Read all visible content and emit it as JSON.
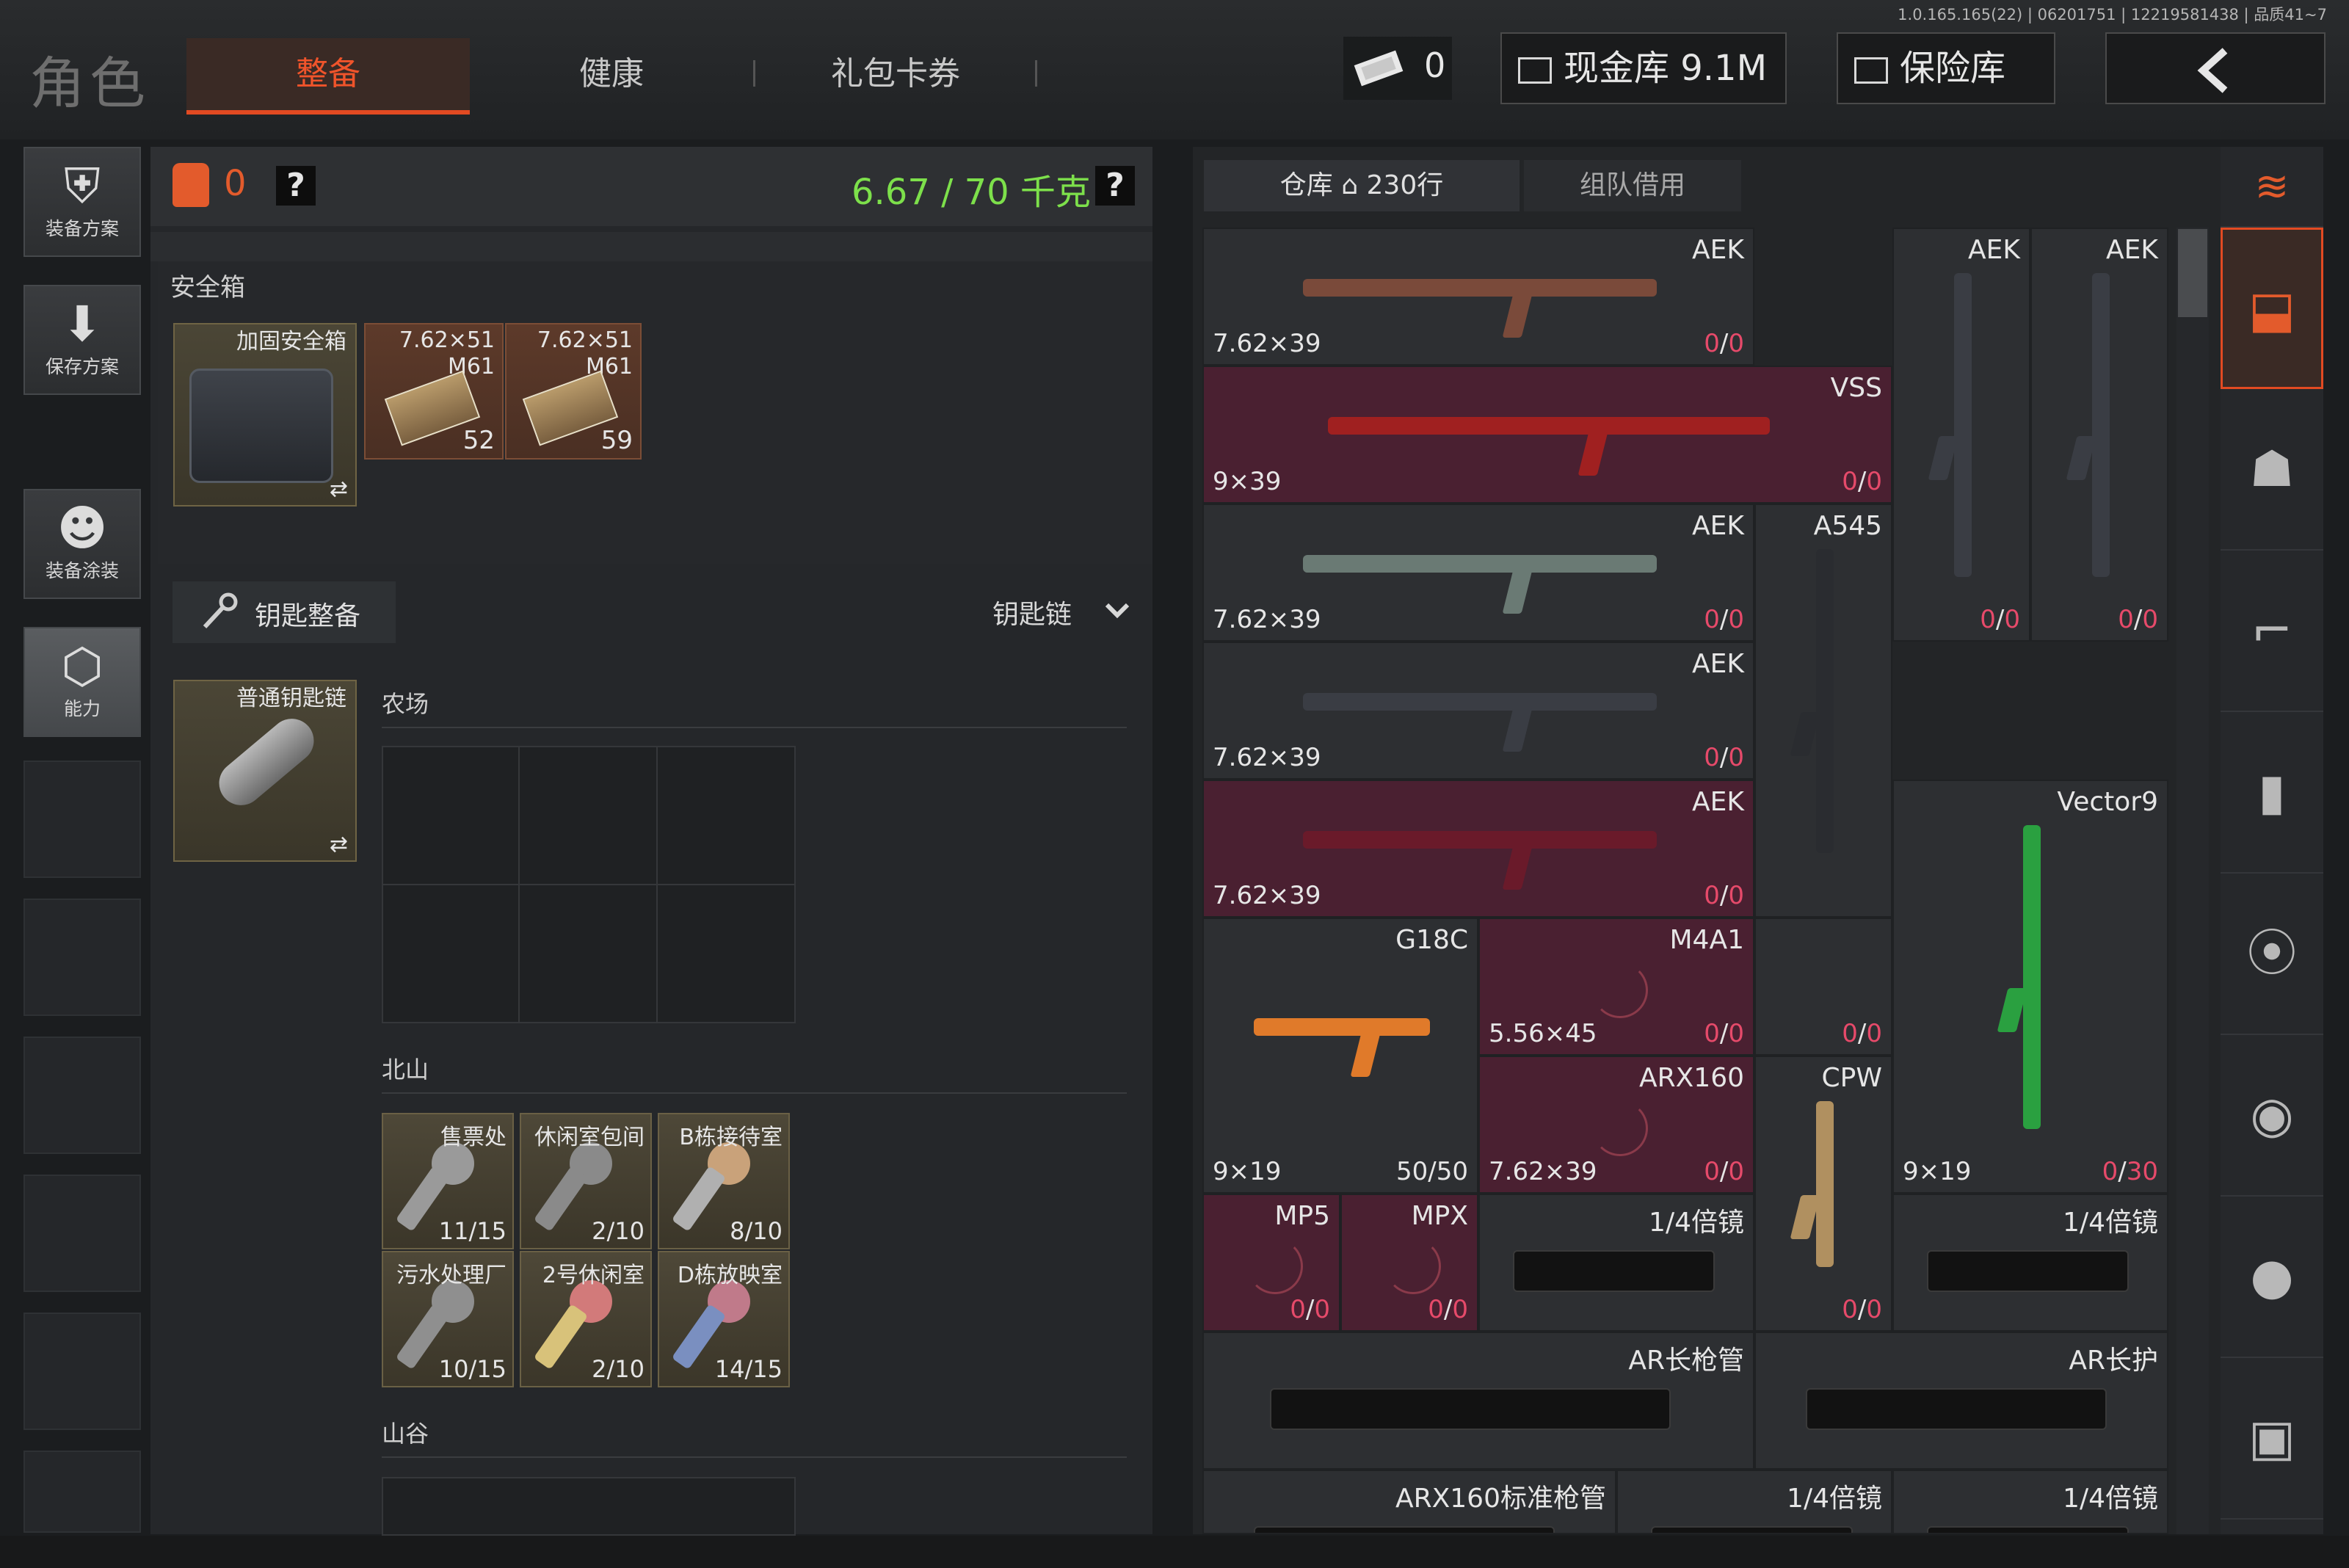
{
  "version": "1.0.165.165(22) | 06201751 | 12219581438 | 品质41~7",
  "header": {
    "title": "角色",
    "tabs": [
      {
        "label": "整备",
        "active": true
      },
      {
        "label": "健康",
        "active": false
      },
      {
        "label": "礼包卡券",
        "active": false
      }
    ],
    "ticket_count": "0",
    "cash_vault": "现金库 9.1M",
    "insurance": "保险库",
    "back_icon": "chevron-left-icon"
  },
  "sidebar": {
    "items": [
      {
        "label": "装备方案",
        "icon": "armor-vest-icon"
      },
      {
        "label": "保存方案",
        "icon": "download-arrow-icon"
      },
      {
        "label": "装备涂装",
        "icon": "helmet-icon"
      },
      {
        "label": "能力",
        "icon": "lightning-hex-icon",
        "active": true
      }
    ]
  },
  "loadout": {
    "backpack_count": "0",
    "help": "?",
    "weight": "6.67 / 70 千克",
    "safe_box_header": "安全箱",
    "safe_box": {
      "name": "加固安全箱",
      "swap": "⇄"
    },
    "ammo": [
      {
        "caliber": "7.62×51",
        "type": "M61",
        "count": "52"
      },
      {
        "caliber": "7.62×51",
        "type": "M61",
        "count": "59"
      }
    ],
    "key_header": "钥匙整备",
    "keychain_label": "钥匙链",
    "keychain": {
      "name": "普通钥匙链",
      "swap": "⇄"
    },
    "sections": {
      "farm": "农场",
      "north_mountain": "北山",
      "valley": "山谷"
    },
    "north_keys": [
      {
        "name": "售票处",
        "count": "11/15",
        "color": "#9a9a9a"
      },
      {
        "name": "休闲室包间",
        "count": "2/10",
        "color": "#8a8a8a"
      },
      {
        "name": "B栋接待室",
        "count": "8/10",
        "color": "#c9a27a"
      },
      {
        "name": "污水处理厂",
        "count": "10/15",
        "color": "#8f8f8f"
      },
      {
        "name": "2号休闲室",
        "count": "2/10",
        "color": "#d8c27a"
      },
      {
        "name": "D栋放映室",
        "count": "14/15",
        "color": "#7a8fc0"
      }
    ]
  },
  "warehouse": {
    "tabs": [
      {
        "label": "仓库 ⌂ 230行",
        "active": true
      },
      {
        "label": "组队借用",
        "active": false
      }
    ],
    "cells": [
      {
        "name": "AEK",
        "caliber": "7.62×39",
        "ammo_a": "0",
        "ammo_b": "0",
        "red": false,
        "color": "#7a4a3a"
      },
      {
        "name": "AEK",
        "caliber": "",
        "ammo_a": "0",
        "ammo_b": "0",
        "red": false,
        "color": "#3a3d44"
      },
      {
        "name": "AEK",
        "caliber": "",
        "ammo_a": "0",
        "ammo_b": "0",
        "red": false,
        "color": "#3a3d44"
      },
      {
        "name": "VSS",
        "caliber": "9×39",
        "ammo_a": "0",
        "ammo_b": "0",
        "red": true,
        "color": "#a02020"
      },
      {
        "name": "AEK",
        "caliber": "7.62×39",
        "ammo_a": "0",
        "ammo_b": "0",
        "red": false,
        "color": "#6a7a74"
      },
      {
        "name": "A545",
        "caliber": "",
        "ammo_a": "",
        "ammo_b": "",
        "red": false,
        "color": "#2a2c30"
      },
      {
        "name": "AEK",
        "caliber": "7.62×39",
        "ammo_a": "0",
        "ammo_b": "0",
        "red": false,
        "color": "#3a3d44"
      },
      {
        "name": "AEK",
        "caliber": "7.62×39",
        "ammo_a": "0",
        "ammo_b": "0",
        "red": true,
        "color": "#6a1a2a"
      },
      {
        "name": "Vector9",
        "caliber": "9×19",
        "ammo_a": "0",
        "ammo_b": "30",
        "red": false,
        "color": "#2aa040"
      },
      {
        "name": "G18C",
        "caliber": "9×19",
        "ammo_a": "50",
        "ammo_b": "50",
        "red": false,
        "color": "#e07a2a"
      },
      {
        "name": "M4A1",
        "caliber": "5.56×45",
        "ammo_a": "0",
        "ammo_b": "0",
        "red": true,
        "color": "#4a2031"
      },
      {
        "name": "",
        "caliber": "",
        "ammo_a": "0",
        "ammo_b": "0",
        "red": false,
        "color": "#2d2f32"
      },
      {
        "name": "ARX160",
        "caliber": "7.62×39",
        "ammo_a": "0",
        "ammo_b": "0",
        "red": true,
        "color": "#4a2031"
      },
      {
        "name": "CPW",
        "caliber": "",
        "ammo_a": "0",
        "ammo_b": "0",
        "red": false,
        "color": "#b09060"
      },
      {
        "name": "MP5",
        "caliber": "",
        "ammo_a": "0",
        "ammo_b": "0",
        "red": true,
        "color": "#4a2031"
      },
      {
        "name": "MPX",
        "caliber": "",
        "ammo_a": "0",
        "ammo_b": "0",
        "red": true,
        "color": "#4a2031"
      },
      {
        "name": "1/4倍镜",
        "caliber": "",
        "ammo_a": "",
        "ammo_b": "",
        "red": false,
        "color": "#2a2a2a"
      },
      {
        "name": "1/4倍镜",
        "caliber": "",
        "ammo_a": "",
        "ammo_b": "",
        "red": false,
        "color": "#2a2a2a"
      },
      {
        "name": "AR长枪管",
        "caliber": "",
        "ammo_a": "",
        "ammo_b": "",
        "red": false,
        "color": "#1e1e1e"
      },
      {
        "name": "AR长护",
        "caliber": "",
        "ammo_a": "",
        "ammo_b": "",
        "red": false,
        "color": "#2a2a2a"
      },
      {
        "name": "ARX160标准枪管",
        "caliber": "",
        "ammo_a": "",
        "ammo_b": "",
        "red": false,
        "color": "#2a2a2a"
      },
      {
        "name": "1/4倍镜",
        "caliber": "",
        "ammo_a": "",
        "ammo_b": "",
        "red": false,
        "color": "#2a2a2a"
      },
      {
        "name": "1/4倍镜",
        "caliber": "",
        "ammo_a": "",
        "ammo_b": "",
        "red": false,
        "color": "#2a2a2a"
      }
    ]
  },
  "filters": [
    {
      "icon": "layers-refresh-icon"
    },
    {
      "icon": "stack-download-icon",
      "active": true
    },
    {
      "icon": "helmet-icon"
    },
    {
      "icon": "rifle-icon"
    },
    {
      "icon": "magazine-icon"
    },
    {
      "icon": "bullet-icon"
    },
    {
      "icon": "scope-icon"
    },
    {
      "icon": "grenade-icon"
    },
    {
      "icon": "box-icon"
    }
  ]
}
